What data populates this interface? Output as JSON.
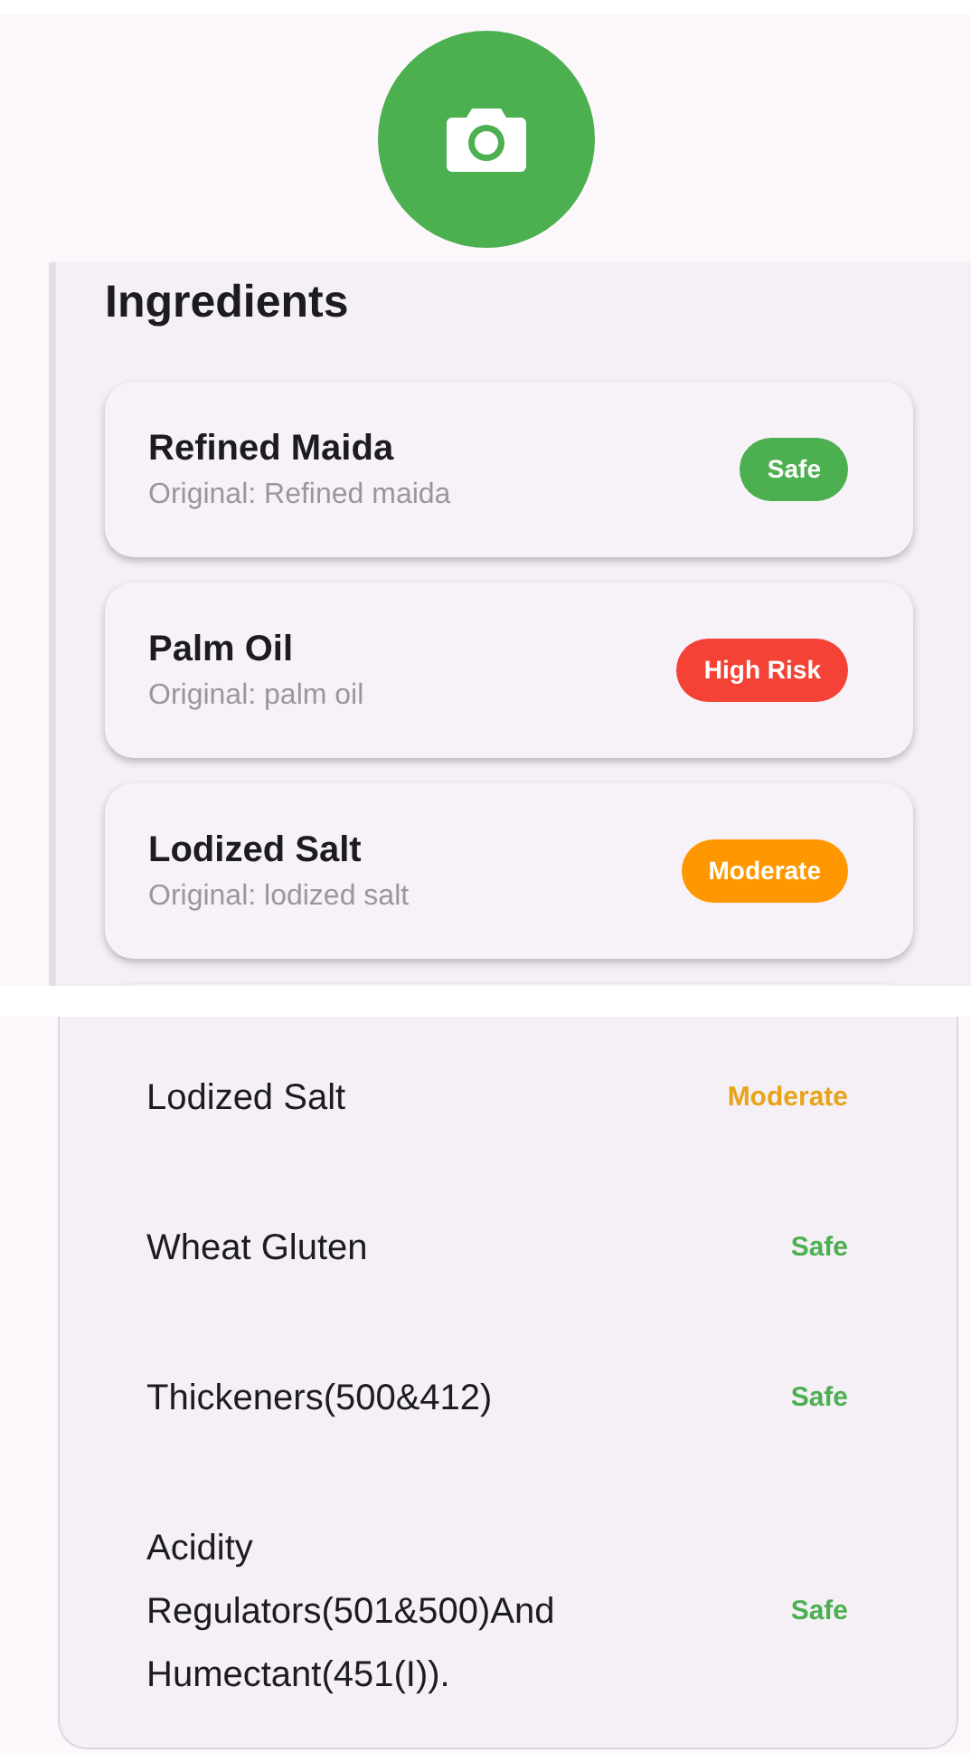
{
  "ingredients_panel": {
    "title": "Ingredients",
    "cards": [
      {
        "name": "Refined Maida",
        "original": "Original: Refined maida",
        "kind": "safe",
        "label": "Safe"
      },
      {
        "name": "Palm Oil",
        "original": "Original: palm oil",
        "kind": "high",
        "label": "High Risk"
      },
      {
        "name": "Lodized Salt",
        "original": "Original: lodized salt",
        "kind": "moderate",
        "label": "Moderate"
      }
    ]
  },
  "summary_list": [
    {
      "name": "Lodized Salt",
      "kind": "moderate",
      "label": "Moderate"
    },
    {
      "name": "Wheat Gluten",
      "kind": "safe",
      "label": "Safe"
    },
    {
      "name": "Thickeners(500&412)",
      "kind": "safe",
      "label": "Safe"
    },
    {
      "name": "Acidity Regulators(501&500)And Humectant(451(I)).",
      "kind": "safe",
      "label": "Safe"
    }
  ]
}
